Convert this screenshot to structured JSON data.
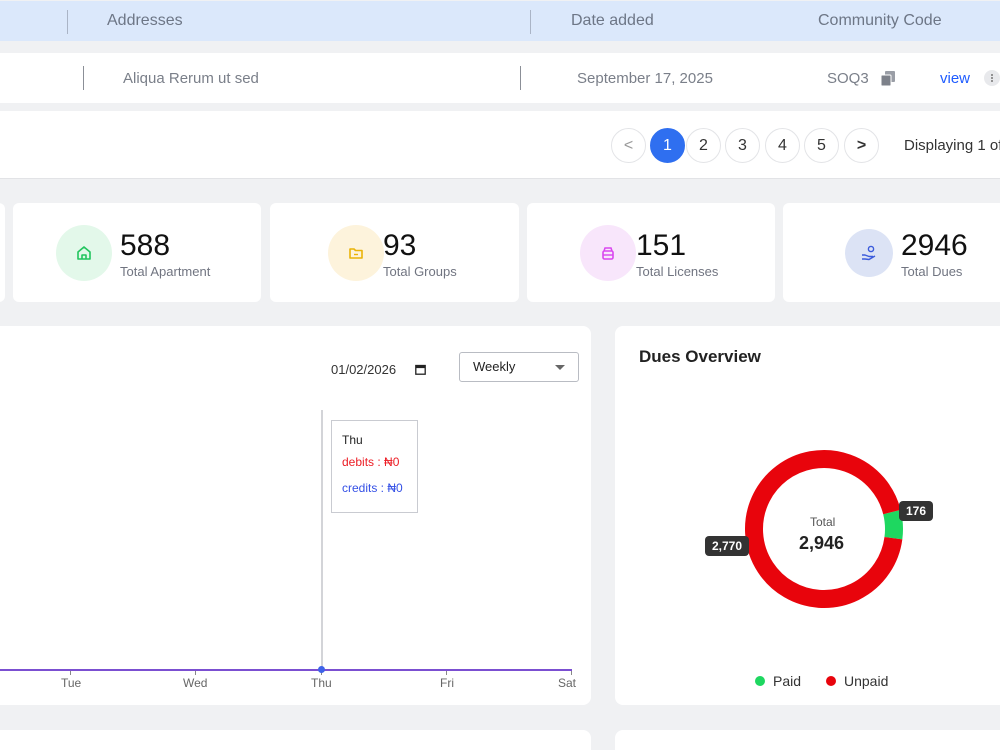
{
  "table": {
    "headers": {
      "addresses": "Addresses",
      "date_added": "Date added",
      "community_code": "Community Code"
    },
    "row": {
      "address": "Aliqua Rerum ut sed",
      "date": "September 17, 2025",
      "code": "SOQ3",
      "action": "view"
    }
  },
  "pagination": {
    "prev": "<",
    "pages": [
      "1",
      "2",
      "3",
      "4",
      "5"
    ],
    "active_page": "1",
    "next": ">",
    "status": "Displaying 1 of"
  },
  "stats": [
    {
      "value": "588",
      "label": "Total Apartment",
      "icon": "home-icon",
      "color": "#22c55e",
      "bg": "#e3f8ea"
    },
    {
      "value": "93",
      "label": "Total Groups",
      "icon": "folder-icon",
      "color": "#eab308",
      "bg": "#fdf3dc"
    },
    {
      "value": "151",
      "label": "Total Licenses",
      "icon": "license-icon",
      "color": "#d946ef",
      "bg": "#f8e6fb"
    },
    {
      "value": "2946",
      "label": "Total Dues",
      "icon": "hand-coin-icon",
      "color": "#3b5bdb",
      "bg": "#dce3f5"
    }
  ],
  "transactions": {
    "date": "01/02/2026",
    "period": "Weekly",
    "x_labels": [
      "Tue",
      "Wed",
      "Thu",
      "Fri",
      "Sat"
    ],
    "tooltip": {
      "day": "Thu",
      "debits": "debits : ₦0",
      "credits": "credits : ₦0"
    },
    "colors": {
      "line": "#7b4fd1",
      "debits": "#ec1c24",
      "credits": "#3450e6"
    }
  },
  "dues_overview": {
    "title": "Dues Overview",
    "total_label": "Total",
    "total_value": "2,946",
    "slices": [
      {
        "name": "Paid",
        "value": 176,
        "label": "176",
        "color": "#1ed760"
      },
      {
        "name": "Unpaid",
        "value": 2770,
        "label": "2,770",
        "color": "#e8040c"
      }
    ]
  }
}
